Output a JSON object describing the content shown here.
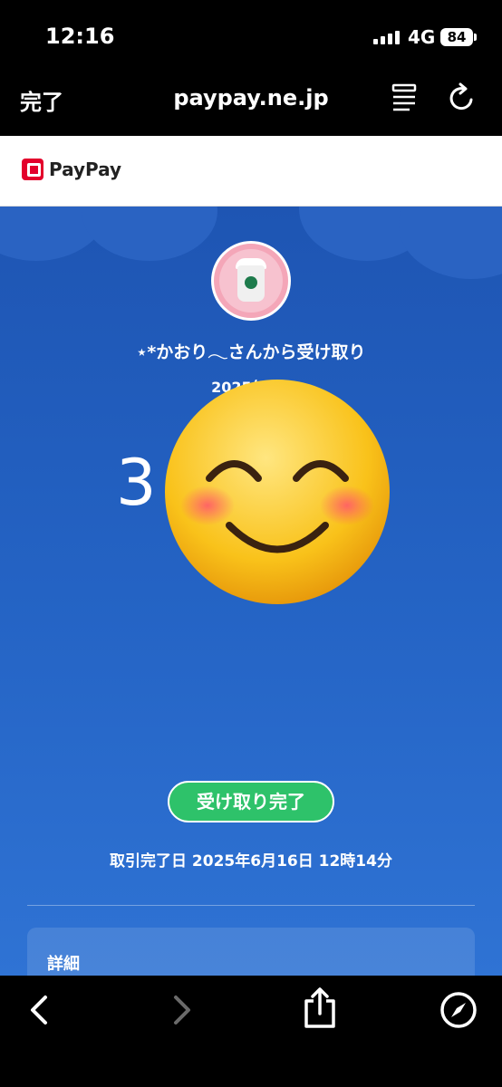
{
  "status_bar": {
    "time": "12:16",
    "network": "4G",
    "battery": "84"
  },
  "browser": {
    "done_label": "完了",
    "url": "paypay.ne.jp",
    "icons": [
      "reader-icon",
      "reload-icon",
      "back-icon",
      "forward-icon",
      "share-icon",
      "compass-icon"
    ]
  },
  "header": {
    "brand": "PayPay",
    "brand_color": "#e3002b"
  },
  "receipt": {
    "sender_line": "⋆*かおり𓂃さんから受け取り",
    "received_datetime": "2025年6月",
    "amount_visible": "3",
    "status_badge": "受け取り完了",
    "completion_date": "取引完了日 2025年6月16日 12時14分",
    "details_title": "詳細"
  },
  "colors": {
    "accent_blue": "#2463c4",
    "badge_green": "#2ec26a"
  }
}
